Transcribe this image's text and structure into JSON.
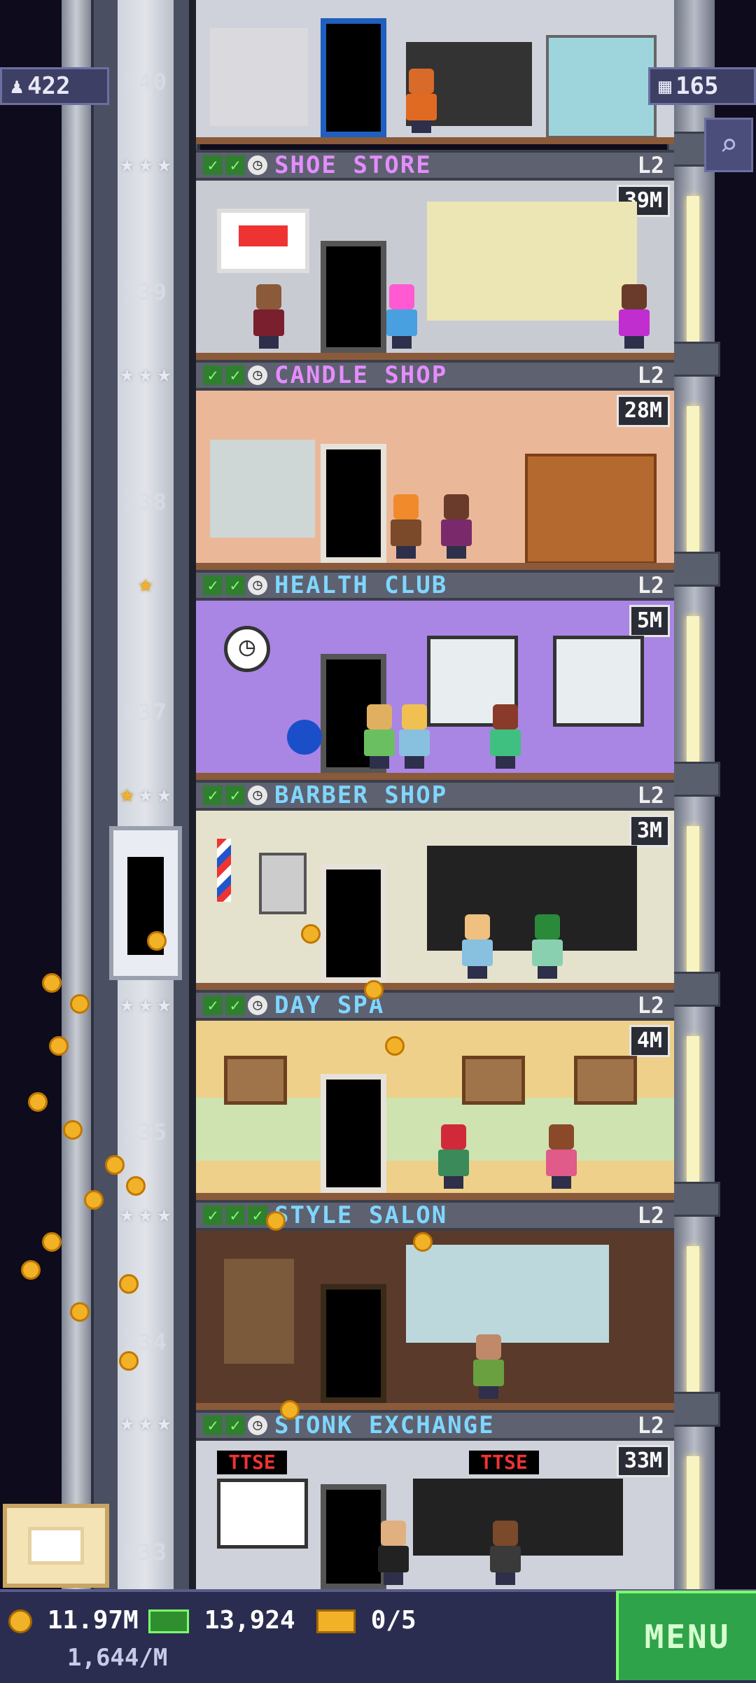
{
  "hud": {
    "population": "422",
    "floor_count": "165"
  },
  "shaft_floor_numbers": [
    "140",
    "139",
    "138",
    "137",
    "135",
    "134",
    "133"
  ],
  "floors": [
    {
      "name": "SHOE STORE",
      "level": "L2",
      "amount": "39M",
      "name_color": "#e58cff"
    },
    {
      "name": "CANDLE SHOP",
      "level": "L2",
      "amount": "28M",
      "name_color": "#e58cff"
    },
    {
      "name": "HEALTH CLUB",
      "level": "L2",
      "amount": "5M",
      "name_color": "#7fd6ff"
    },
    {
      "name": "BARBER SHOP",
      "level": "L2",
      "amount": "3M",
      "name_color": "#7fd6ff"
    },
    {
      "name": "DAY SPA",
      "level": "L2",
      "amount": "4M",
      "name_color": "#7fd6ff"
    },
    {
      "name": "STYLE SALON",
      "level": "L2",
      "amount": "",
      "name_color": "#7fd6ff"
    },
    {
      "name": "STONK EXCHANGE",
      "level": "L2",
      "amount": "33M",
      "name_color": "#7fd6ff"
    }
  ],
  "bottom_bar": {
    "coins": "11.97M",
    "coin_rate": "1,644/M",
    "bux": "13,924",
    "tickets": "0/5",
    "menu_label": "MENU"
  },
  "signs": {
    "stonk_sign": "TTSE"
  },
  "colors": {
    "accent_green": "#2fa34a",
    "coin_gold": "#f2b228",
    "header_bg": "#5d6170"
  }
}
